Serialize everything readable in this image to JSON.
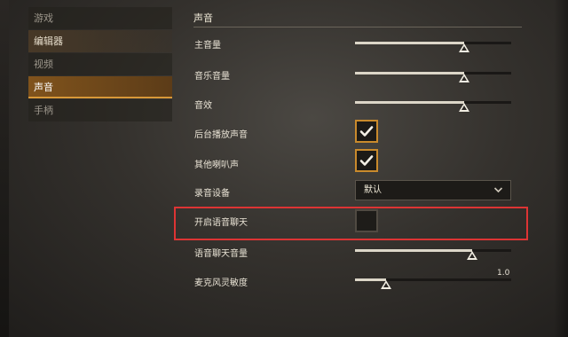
{
  "sidebar": {
    "items": [
      {
        "label": "游戏"
      },
      {
        "label": "编辑器"
      },
      {
        "label": "视频"
      },
      {
        "label": "声音"
      },
      {
        "label": "手柄"
      }
    ]
  },
  "section": {
    "title": "声音"
  },
  "settings": {
    "master_volume": {
      "label": "主音量",
      "value": 0.7
    },
    "music_volume": {
      "label": "音乐音量",
      "value": 0.7
    },
    "sfx_volume": {
      "label": "音效",
      "value": 0.7
    },
    "background_audio": {
      "label": "后台播放声音",
      "checked": true
    },
    "other_speakers": {
      "label": "其他喇叭声",
      "checked": true
    },
    "recording_device": {
      "label": "录音设备",
      "value": "默认"
    },
    "voice_chat": {
      "label": "开启语音聊天",
      "checked": false
    },
    "voice_chat_volume": {
      "label": "语音聊天音量",
      "value": 0.75
    },
    "mic_sensitivity": {
      "label": "麦克风灵敏度",
      "value": 0.2,
      "display": "1.0"
    }
  },
  "colors": {
    "accent": "#c98a2c",
    "highlight": "#dd3434"
  },
  "icons": {
    "check": "checkmark-icon",
    "dropdown": "chevron-down-icon"
  }
}
